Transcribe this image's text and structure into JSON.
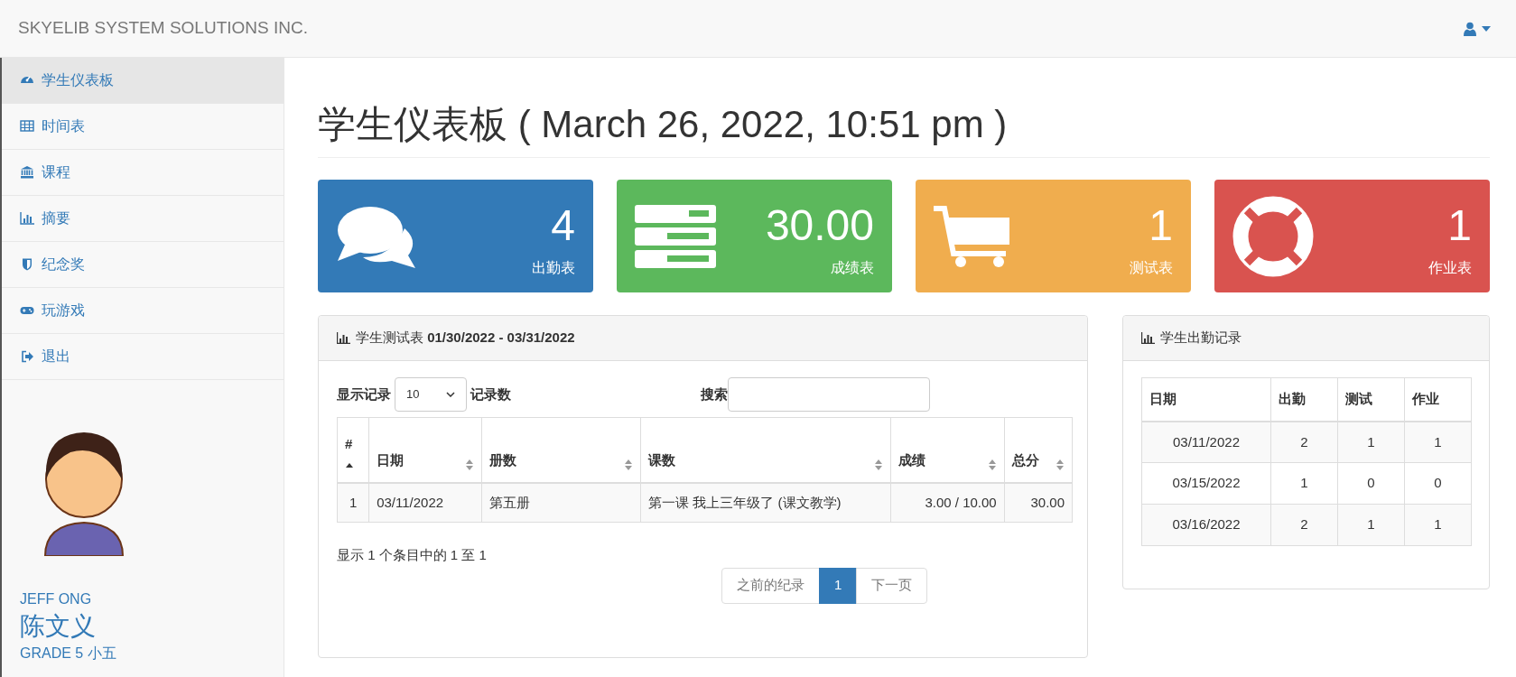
{
  "navbar": {
    "brand": "SKYELIB SYSTEM SOLUTIONS INC."
  },
  "sidebar": {
    "items": [
      {
        "label": "学生仪表板",
        "kind": "dashboard",
        "selected": true
      },
      {
        "label": "时间表",
        "kind": "table",
        "selected": false
      },
      {
        "label": "课程",
        "kind": "bank",
        "selected": false
      },
      {
        "label": "摘要",
        "kind": "chart",
        "selected": false
      },
      {
        "label": "纪念奖",
        "kind": "shield",
        "selected": false
      },
      {
        "label": "玩游戏",
        "kind": "gamepad",
        "selected": false
      },
      {
        "label": "退出",
        "kind": "logout",
        "selected": false
      }
    ],
    "profile": {
      "name": "JEFF ONG",
      "chinese_name": "陈文义",
      "grade": "GRADE 5 小五"
    }
  },
  "page_title": "学生仪表板 ( March 26, 2022, 10:51 pm )",
  "stat_cards": [
    {
      "kind": "comments",
      "value": "4",
      "label": "出勤表",
      "color": "#337ab7"
    },
    {
      "kind": "tasks",
      "value": "30.00",
      "label": "成绩表",
      "color": "#5cb85c"
    },
    {
      "kind": "cart",
      "value": "1",
      "label": "测试表",
      "color": "#f0ad4e"
    },
    {
      "kind": "lifebuoy",
      "value": "1",
      "label": "作业表",
      "color": "#d9534f"
    }
  ],
  "tests_panel": {
    "title": "学生测试表 **01/30/2022 - 03/31/2022**",
    "length_label": "显示记录",
    "length_value": "10",
    "length_suffix": "记录数",
    "search_label": "搜索",
    "columns": [
      {
        "label": "#",
        "sorted": true
      },
      {
        "label": "日期",
        "sorted": false
      },
      {
        "label": "册数",
        "sorted": false
      },
      {
        "label": "课数",
        "sorted": false
      },
      {
        "label": "成绩",
        "sorted": false
      },
      {
        "label": "总分",
        "sorted": false
      }
    ],
    "rows": [
      [
        "1",
        "03/11/2022",
        "第五册",
        "第一课 我上三年级了 (课文教学)",
        "3.00 / 10.00",
        "30.00"
      ]
    ],
    "info": "显示 1 个条目中的 1 至 1",
    "pagination": [
      {
        "label": "之前的纪录",
        "selected": false,
        "disabled": true
      },
      {
        "label": "1",
        "selected": true,
        "disabled": false
      },
      {
        "label": "下一页",
        "selected": false,
        "disabled": true
      }
    ]
  },
  "attendance_panel": {
    "title": "学生出勤记录",
    "columns": [
      "日期",
      "出勤",
      "测试",
      "作业"
    ],
    "rows": [
      [
        "03/11/2022",
        "2",
        "1",
        "1"
      ],
      [
        "03/15/2022",
        "1",
        "0",
        "0"
      ],
      [
        "03/16/2022",
        "2",
        "1",
        "1"
      ]
    ]
  }
}
